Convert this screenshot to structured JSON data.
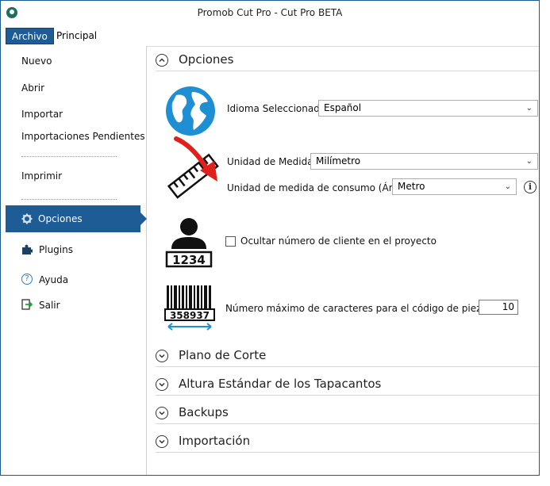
{
  "window": {
    "title": "Promob Cut Pro - Cut Pro BETA"
  },
  "ribbon": {
    "tabs": [
      {
        "label": "Archivo",
        "active": true
      },
      {
        "label": "Principal",
        "active": false
      }
    ]
  },
  "sidebar": {
    "items": [
      {
        "label": "Nuevo"
      },
      {
        "label": "Abrir"
      },
      {
        "label": "Importar"
      },
      {
        "label": "Importaciones Pendientes"
      },
      {
        "label": "Imprimir"
      },
      {
        "label": "Opciones",
        "selected": true,
        "icon": "gear-icon"
      },
      {
        "label": "Plugins",
        "icon": "puzzle-icon"
      },
      {
        "label": "Ayuda",
        "icon": "help-icon"
      },
      {
        "label": "Salir",
        "icon": "exit-icon"
      }
    ]
  },
  "options": {
    "section_title": "Opciones",
    "language": {
      "label": "Idioma Seleccionado:",
      "value": "Español",
      "icon": "globe-icon"
    },
    "measure": {
      "label": "Unidad de Medida:",
      "value": "Milímetro",
      "icon": "ruler-icon"
    },
    "consumption": {
      "label": "Unidad de medida de consumo (Área):",
      "value": "Metro",
      "info_icon": "info-icon"
    },
    "client": {
      "label": "Ocultar número de cliente en el proyecto",
      "checked": false,
      "icon_number": "1234",
      "icon": "user-badge-icon"
    },
    "piece_code": {
      "label": "Número máximo de caracteres para el código de pieza.",
      "value": "10",
      "icon_number": "358937",
      "icon": "barcode-icon"
    }
  },
  "sections": [
    {
      "title": "Plano de Corte"
    },
    {
      "title": "Altura Estándar de los Tapacantos"
    },
    {
      "title": "Backups"
    },
    {
      "title": "Importación"
    }
  ],
  "colors": {
    "accent": "#1e5c96",
    "annotation_arrow": "#e0201b",
    "globe": "#1f8fd4"
  }
}
